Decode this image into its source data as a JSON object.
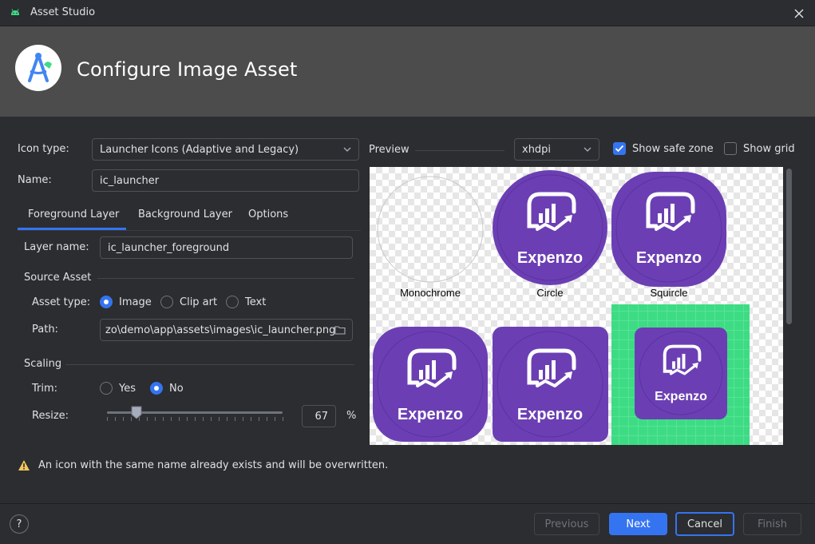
{
  "window": {
    "title": "Asset Studio"
  },
  "header": {
    "title": "Configure Image Asset"
  },
  "form": {
    "icon_type_label": "Icon type:",
    "icon_type_value": "Launcher Icons (Adaptive and Legacy)",
    "name_label": "Name:",
    "name_value": "ic_launcher"
  },
  "tabs": [
    {
      "label": "Foreground Layer",
      "active": true
    },
    {
      "label": "Background Layer",
      "active": false
    },
    {
      "label": "Options",
      "active": false
    }
  ],
  "layer": {
    "layer_name_label": "Layer name:",
    "layer_name_value": "ic_launcher_foreground",
    "source_asset_title": "Source Asset",
    "asset_type_label": "Asset type:",
    "asset_type_options": [
      "Image",
      "Clip art",
      "Text"
    ],
    "asset_type_selected": "Image",
    "path_label": "Path:",
    "path_value": "zo\\demo\\app\\assets\\images\\ic_launcher.png",
    "scaling_title": "Scaling",
    "trim_label": "Trim:",
    "trim_options": [
      "Yes",
      "No"
    ],
    "trim_selected": "No",
    "resize_label": "Resize:",
    "resize_value": "67",
    "resize_unit": "%"
  },
  "preview": {
    "label": "Preview",
    "density_value": "xhdpi",
    "show_safe_zone_label": "Show safe zone",
    "show_safe_zone_checked": true,
    "show_grid_label": "Show grid",
    "show_grid_checked": false,
    "brand_text": "Expenzo",
    "brand_color": "#6b3fb3",
    "icons": [
      {
        "label": "Monochrome"
      },
      {
        "label": "Circle"
      },
      {
        "label": "Squircle"
      }
    ]
  },
  "warning": {
    "text": "An icon with the same name already exists and will be overwritten.",
    "icon": "warning-icon"
  },
  "footer": {
    "help_label": "?",
    "previous_label": "Previous",
    "next_label": "Next",
    "cancel_label": "Cancel",
    "finish_label": "Finish"
  },
  "colors": {
    "accent": "#3574f0",
    "grid_green": "#3ddc84",
    "warning": "#f2c55c"
  }
}
